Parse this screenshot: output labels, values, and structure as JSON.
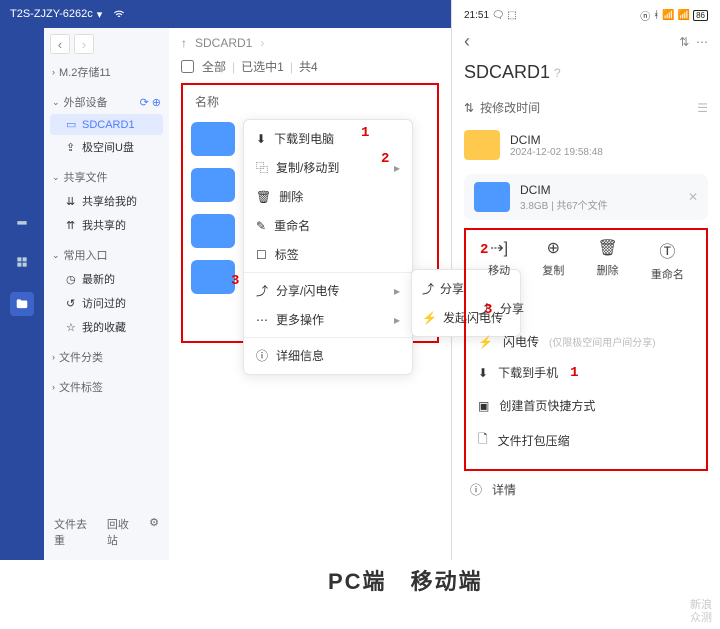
{
  "pc": {
    "title": "T2S-ZJZY-6262c",
    "sidebar": {
      "storage": "M.2存储11",
      "external": "外部设备",
      "sdcard": "SDCARD1",
      "udisk": "极空间U盘",
      "share": "共享文件",
      "shared_to_me": "共享给我的",
      "my_shared": "我共享的",
      "common": "常用入口",
      "latest": "最新的",
      "visited": "访问过的",
      "favorite": "我的收藏",
      "category": "文件分类",
      "tags": "文件标签"
    },
    "footer": {
      "dedup": "文件去重",
      "recycle": "回收站"
    },
    "crumb": "SDCARD1",
    "selbar": {
      "all": "全部",
      "selected": "已选中1",
      "total": "共4"
    },
    "colhead": "名称",
    "menu": {
      "download": "下载到电脑",
      "copy_move": "复制/移动到",
      "delete": "删除",
      "rename": "重命名",
      "tag": "标签",
      "share_fast": "分享/闪电传",
      "more": "更多操作",
      "details": "详细信息"
    },
    "submenu": {
      "share": "分享",
      "fast": "发起闪电传"
    }
  },
  "mobile": {
    "time": "21:51",
    "battery": "86",
    "title": "SDCARD1",
    "sort": "按修改时间",
    "file": {
      "name": "DCIM",
      "date": "2024-12-02 19:58:48"
    },
    "card": {
      "name": "DCIM",
      "meta": "3.8GB | 共67个文件"
    },
    "actions": {
      "move": "移动",
      "copy": "复制",
      "delete": "删除",
      "rename": "重命名"
    },
    "list": {
      "share": "分享",
      "fast": "闪电传",
      "fast_hint": "(仅限极空间用户间分享)",
      "download": "下载到手机",
      "shortcut": "创建首页快捷方式",
      "pack": "文件打包压缩"
    },
    "details": "详情"
  },
  "labels": {
    "pc": "PC端",
    "mobile": "移动端"
  },
  "watermark": {
    "l1": "新浪",
    "l2": "众测"
  }
}
